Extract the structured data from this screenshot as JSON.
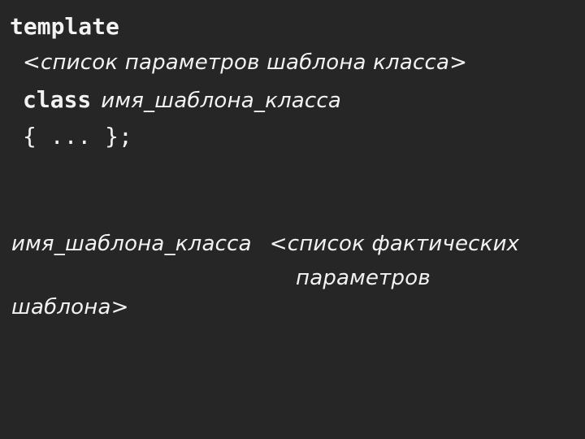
{
  "slide": {
    "background_color": "#262626",
    "text_color": "#f2f2f2",
    "title": "template",
    "declaration_block": {
      "keyword_template": "template",
      "template_parameter_list": "<список параметров шаблона класса>",
      "keyword_class": "class",
      "class_template_name": "имя_шаблона_класса",
      "class_body": "{ ... };"
    },
    "instantiation_block": {
      "class_template_name": "имя_шаблона_класса",
      "actual_arguments_line_1": "<список фактических",
      "actual_arguments_line_2": "параметров",
      "actual_arguments_line_3": "шаблона>"
    }
  }
}
